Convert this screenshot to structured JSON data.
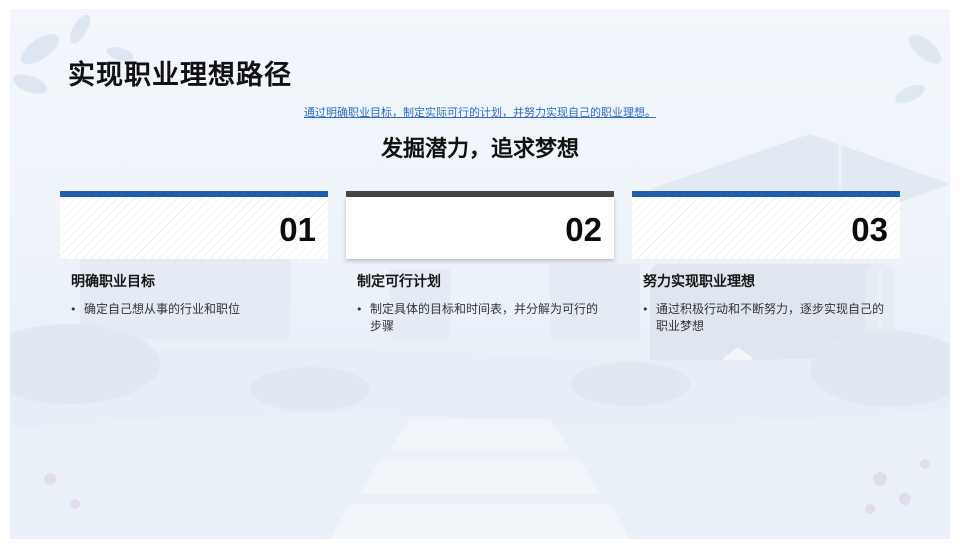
{
  "slide": {
    "title": "实现职业理想路径",
    "subtitle_link": "通过明确职业目标，制定实际可行的计划，并努力实现自己的职业理想。",
    "headline": "发掘潜力，追求梦想"
  },
  "cards": [
    {
      "number": "01",
      "title": "明确职业目标",
      "bullet": "确定自己想从事的行业和职位"
    },
    {
      "number": "02",
      "title": "制定可行计划",
      "bullet": "制定具体的目标和时间表，并分解为可行的步骤"
    },
    {
      "number": "03",
      "title": "努力实现职业理想",
      "bullet": "通过积极行动和不断努力，逐步实现自己的职业梦想"
    }
  ],
  "bullet_symbol": "•",
  "colors": {
    "accent_blue": "#1f5fb0",
    "accent_dark": "#454545",
    "link": "#2e6cc0",
    "text": "#111111"
  },
  "icons": [
    "leaf-decoration-icon",
    "graduation-cap-icon",
    "diploma-scroll-icon",
    "house-icon",
    "flower-decoration-icon"
  ]
}
